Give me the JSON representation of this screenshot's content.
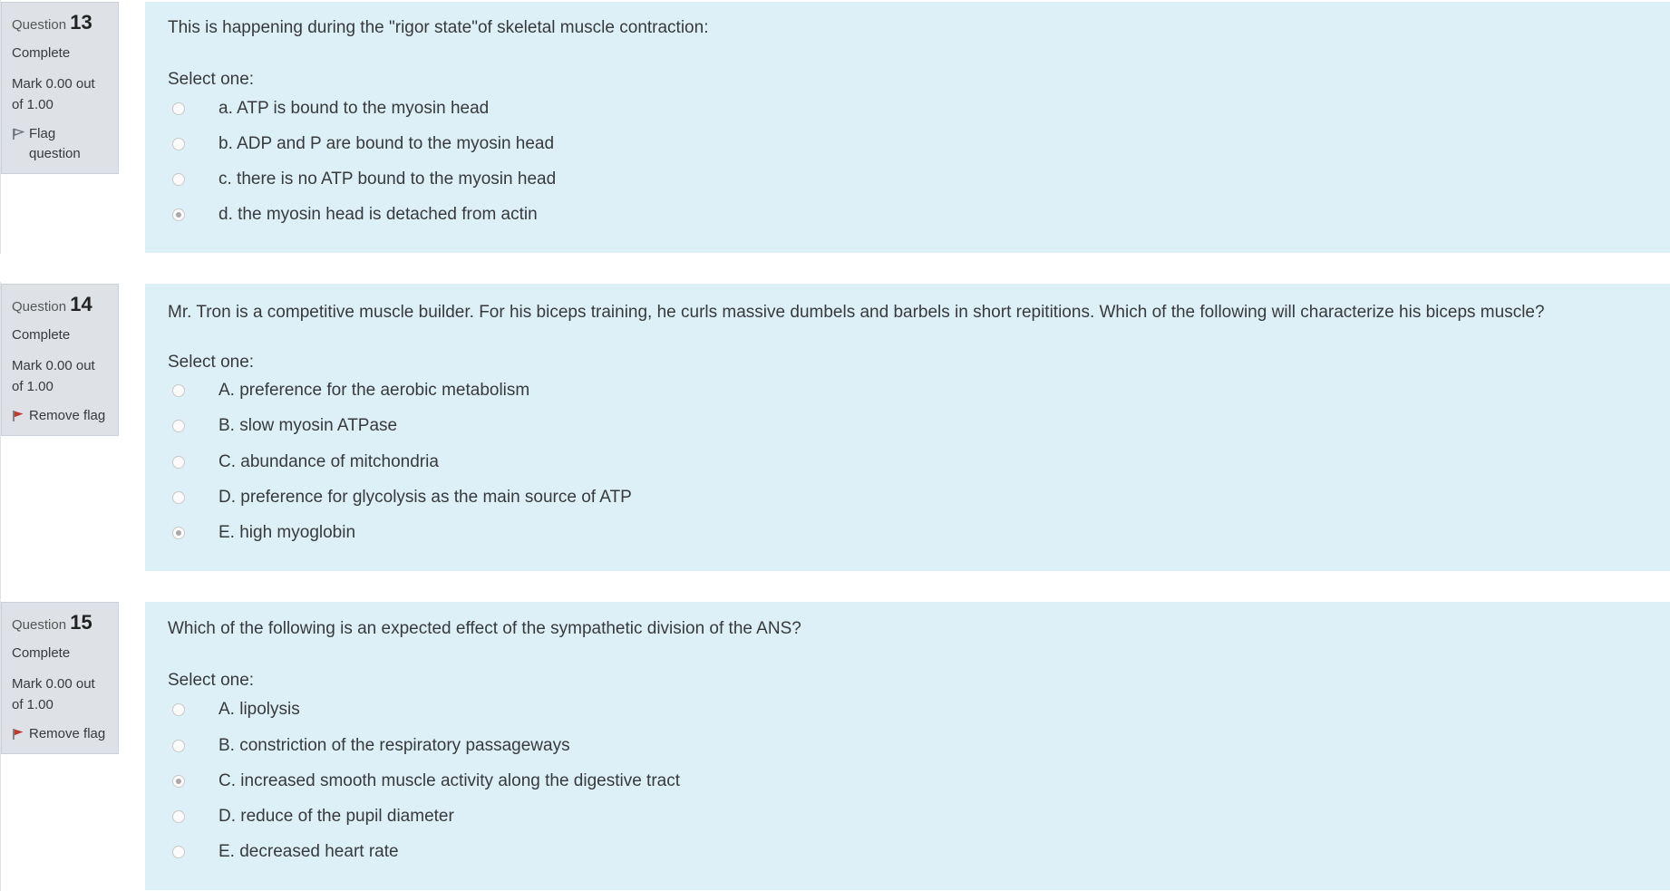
{
  "question_label": "Question",
  "questions": [
    {
      "number": "13",
      "state": "Complete",
      "grade": "Mark 0.00 out of 1.00",
      "flag_label": "Flag question",
      "flagged": false,
      "text": "This is happening during the \"rigor state\"of skeletal muscle contraction:",
      "prompt": "Select one:",
      "answers": [
        {
          "label": "a. ATP is bound to the myosin head",
          "selected": false
        },
        {
          "label": "b. ADP and P are bound to the myosin head",
          "selected": false
        },
        {
          "label": "c. there is no ATP bound to the myosin head",
          "selected": false
        },
        {
          "label": "d. the myosin head is detached from actin",
          "selected": true
        }
      ]
    },
    {
      "number": "14",
      "state": "Complete",
      "grade": "Mark 0.00 out of 1.00",
      "flag_label": "Remove flag",
      "flagged": true,
      "text": "Mr. Tron is a competitive muscle builder. For his biceps training, he curls massive dumbels and barbels in short repititions. Which of the following will characterize his biceps muscle?",
      "prompt": "Select one:",
      "answers": [
        {
          "label": "A. preference for the aerobic metabolism",
          "selected": false
        },
        {
          "label": "B. slow myosin ATPase",
          "selected": false
        },
        {
          "label": "C. abundance of mitchondria",
          "selected": false
        },
        {
          "label": "D. preference for glycolysis as the main source of ATP",
          "selected": false
        },
        {
          "label": "E. high myoglobin",
          "selected": true
        }
      ]
    },
    {
      "number": "15",
      "state": "Complete",
      "grade": "Mark 0.00 out of 1.00",
      "flag_label": "Remove flag",
      "flagged": true,
      "text": "Which of the following is an expected effect of the sympathetic division of the ANS?",
      "prompt": "Select one:",
      "answers": [
        {
          "label": "A. lipolysis",
          "selected": false
        },
        {
          "label": "B. constriction of the respiratory passageways",
          "selected": false
        },
        {
          "label": "C. increased smooth muscle activity along the digestive tract",
          "selected": true
        },
        {
          "label": "D. reduce of the pupil diameter",
          "selected": false
        },
        {
          "label": "E. decreased heart rate",
          "selected": false
        }
      ]
    }
  ],
  "colors": {
    "info_bg": "#dee2e6",
    "content_bg": "#def0f7",
    "flag_active": "#c0392b",
    "flag_inactive": "#6a737b"
  }
}
